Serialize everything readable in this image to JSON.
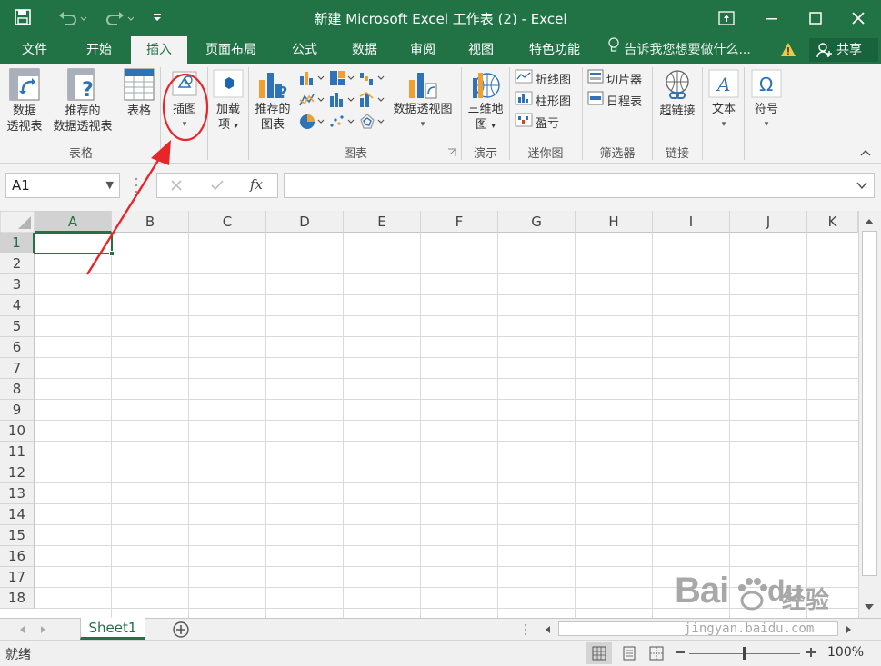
{
  "window": {
    "title": "新建 Microsoft Excel 工作表 (2) - Excel"
  },
  "tabs": [
    "文件",
    "开始",
    "插入",
    "页面布局",
    "公式",
    "数据",
    "审阅",
    "视图",
    "特色功能"
  ],
  "tell_me": "告诉我您想要做什么...",
  "share": "共享",
  "ribbon": {
    "pivot_table": [
      "数据",
      "透视表"
    ],
    "recommended_pivot": [
      "推荐的",
      "数据透视表"
    ],
    "table": "表格",
    "illustrations": "插图",
    "addins": [
      "加载",
      "项"
    ],
    "recommended_charts": [
      "推荐的",
      "图表"
    ],
    "pivot_chart": "数据透视图",
    "map3d": [
      "三维地",
      "图"
    ],
    "sparkline_line": "折线图",
    "sparkline_column": "柱形图",
    "sparkline_winloss": "盈亏",
    "slicer": "切片器",
    "timeline": "日程表",
    "hyperlink": "超链接",
    "text": "文本",
    "symbol": "符号",
    "groups": {
      "tables": "表格",
      "charts": "图表",
      "tours": "演示",
      "sparklines": "迷你图",
      "filters": "筛选器",
      "links": "链接"
    }
  },
  "formula_bar": {
    "name_box": "A1",
    "fx": "fx"
  },
  "columns": [
    "A",
    "B",
    "C",
    "D",
    "E",
    "F",
    "G",
    "H",
    "I",
    "J",
    "K"
  ],
  "rows": [
    "1",
    "2",
    "3",
    "4",
    "5",
    "6",
    "7",
    "8",
    "9",
    "10",
    "11",
    "12",
    "13",
    "14",
    "15",
    "16",
    "17",
    "18"
  ],
  "sheet_tab": "Sheet1",
  "status": {
    "ready": "就绪",
    "zoom": "100%"
  },
  "watermark": {
    "brand": "Bai",
    "brand2": "du",
    "cn": "经验",
    "url": "jingyan.baidu.com"
  },
  "colors": {
    "excel_green": "#217346",
    "annotation_red": "#e8262a"
  }
}
